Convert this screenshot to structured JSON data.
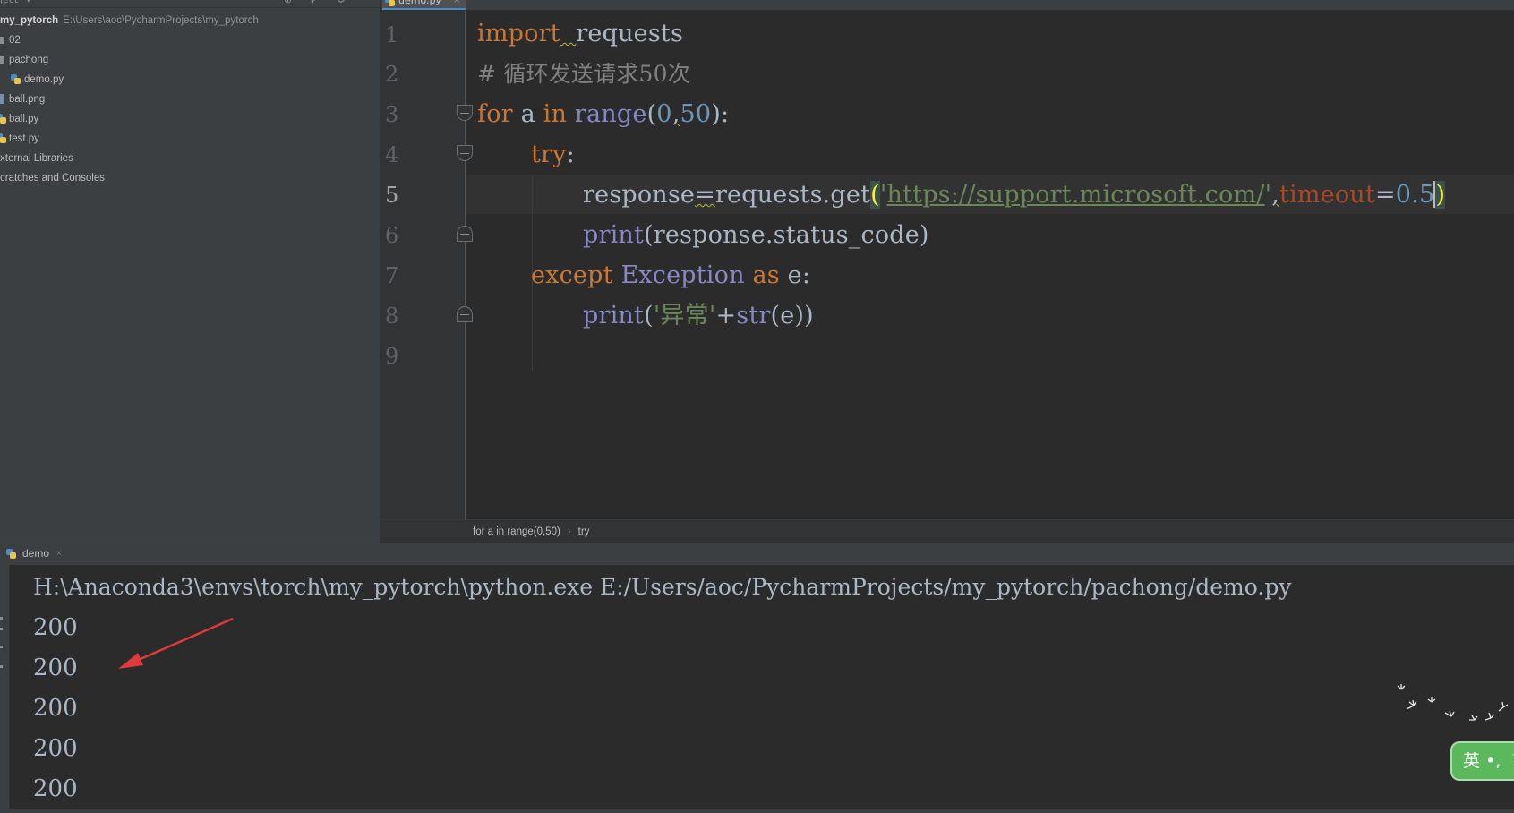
{
  "project": {
    "toolbar_label": "ject",
    "root": {
      "name": "my_pytorch",
      "path": "E:\\Users\\aoc\\PycharmProjects\\my_pytorch"
    },
    "items": [
      {
        "label": "02",
        "icon": "folder-icon"
      },
      {
        "label": "pachong",
        "icon": "folder-icon"
      },
      {
        "label": "demo.py",
        "icon": "python-file-icon"
      },
      {
        "label": "ball.png",
        "icon": "image-file-icon"
      },
      {
        "label": "ball.py",
        "icon": "python-file-icon"
      },
      {
        "label": "test.py",
        "icon": "python-file-icon"
      },
      {
        "label": "xternal Libraries",
        "icon": ""
      },
      {
        "label": "cratches and Consoles",
        "icon": ""
      }
    ]
  },
  "editor": {
    "tab_label": "demo.py",
    "current_line": 5,
    "line_numbers": [
      "1",
      "2",
      "3",
      "4",
      "5",
      "6",
      "7",
      "8",
      "9"
    ],
    "code": {
      "l1_kw": "import",
      "l1_mod": "requests",
      "l2_comment": "# 循环发送请求50次",
      "l3_for": "for",
      "l3_var": "a",
      "l3_in": "in",
      "l3_range": "range",
      "l3_open": "(",
      "l3_n0": "0",
      "l3_comma": ",",
      "l3_n50": "50",
      "l3_close": "):",
      "l4_try": "try",
      "l4_colon": ":",
      "l5_lhs": "response",
      "l5_eq": "=",
      "l5_call": "requests.get",
      "l5_open": "(",
      "l5_q1": "'",
      "l5_url": "https://support.microsoft.com/",
      "l5_q2": "'",
      "l5_comma": ",",
      "l5_param": "timeout",
      "l5_eq2": "=",
      "l5_val": "0.5",
      "l5_close": ")",
      "l6_print": "print",
      "l6_args": "(response.status_code)",
      "l7_except": "except",
      "l7_exc": "Exception",
      "l7_as": "as",
      "l7_var": "e:",
      "l8_print": "print",
      "l8_open": "(",
      "l8_str": "'异常'",
      "l8_plus": "+",
      "l8_str_fn": "str",
      "l8_rest": "(e))"
    }
  },
  "breadcrumb": {
    "items": [
      "for a in range(0,50)",
      "try"
    ]
  },
  "run": {
    "tab_label": "demo",
    "command": "H:\\Anaconda3\\envs\\torch\\my_pytorch\\python.exe E:/Users/aoc/PycharmProjects/my_pytorch/pachong/demo.py",
    "output": [
      "200",
      "200",
      "200",
      "200",
      "200"
    ]
  },
  "ime": {
    "label": "英 •, ☽"
  },
  "colors": {
    "background": "#2b2b2b",
    "panel": "#3c3f41",
    "keyword": "#cc7832",
    "number": "#6897bb",
    "string": "#6a8759",
    "builtin": "#8888c6",
    "arrow": "#e03a3a",
    "ime": "#5cb85c"
  }
}
